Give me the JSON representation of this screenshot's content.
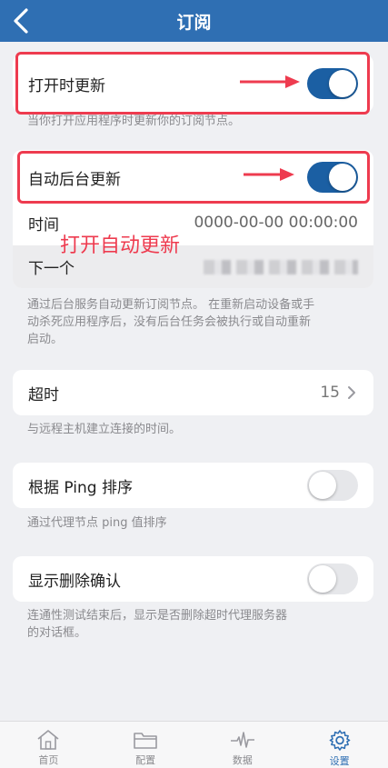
{
  "nav": {
    "title": "订阅",
    "back_icon": "chevron-left-icon"
  },
  "open_update": {
    "label": "打开时更新",
    "enabled": true,
    "description": "当你打开应用程序时更新你的订阅节点。"
  },
  "auto_update": {
    "label": "自动后台更新",
    "enabled": true,
    "time_label": "时间",
    "time_value": "0000-00-00 00:00:00",
    "next_label": "下一个",
    "description_line1": "通过后台服务自动更新订阅节点。 在重新启动设备或手",
    "description_line2": "动杀死应用程序后，没有后台任务会被执行或自动重新",
    "description_line3": "启动。"
  },
  "annotation": "打开自动更新",
  "timeout": {
    "label": "超时",
    "value": "15",
    "description": "与远程主机建立连接的时间。"
  },
  "ping_sort": {
    "label": "根据 Ping 排序",
    "enabled": false,
    "description": "通过代理节点 ping 值排序"
  },
  "delete_confirm": {
    "label": "显示删除确认",
    "enabled": false,
    "description_line1": "连通性测试结束后，显示是否删除超时代理服务器",
    "description_line2": "的对话框。"
  },
  "tabs": [
    {
      "label": "首页",
      "icon": "home-icon",
      "active": false
    },
    {
      "label": "配置",
      "icon": "folder-icon",
      "active": false
    },
    {
      "label": "数据",
      "icon": "pulse-icon",
      "active": false
    },
    {
      "label": "设置",
      "icon": "gear-icon",
      "active": true
    }
  ],
  "colors": {
    "nav": "#2f6fb3",
    "switch_on": "#1b5fa3",
    "annotation": "#ee3b4f",
    "background": "#eff0f3"
  }
}
